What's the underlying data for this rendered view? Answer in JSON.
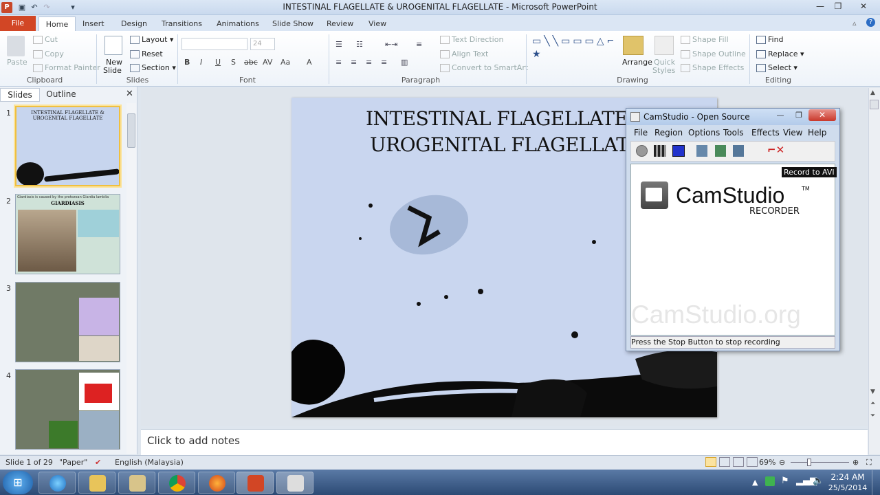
{
  "titlebar": {
    "title": "INTESTINAL FLAGELLATE & UROGENITAL FLAGELLATE - Microsoft PowerPoint",
    "app_icon": "P"
  },
  "ribbon_tabs": {
    "file": "File",
    "tabs": [
      "Home",
      "Insert",
      "Design",
      "Transitions",
      "Animations",
      "Slide Show",
      "Review",
      "View"
    ]
  },
  "clipboard": {
    "paste": "Paste",
    "cut": "Cut",
    "copy": "Copy",
    "format_painter": "Format Painter",
    "label": "Clipboard"
  },
  "slides_group": {
    "new_slide_1": "New",
    "new_slide_2": "Slide",
    "layout": "Layout",
    "reset": "Reset",
    "section": "Section",
    "label": "Slides"
  },
  "font_group": {
    "font_size": "24",
    "label": "Font"
  },
  "paragraph_group": {
    "text_direction": "Text Direction",
    "align_text": "Align Text",
    "convert_smartart": "Convert to SmartArt",
    "label": "Paragraph"
  },
  "drawing_group": {
    "arrange": "Arrange",
    "quick_styles_1": "Quick",
    "quick_styles_2": "Styles",
    "shape_fill": "Shape Fill",
    "shape_outline": "Shape Outline",
    "shape_effects": "Shape Effects",
    "label": "Drawing"
  },
  "editing_group": {
    "find": "Find",
    "replace": "Replace",
    "select": "Select",
    "label": "Editing"
  },
  "left_panel": {
    "tab_slides": "Slides",
    "tab_outline": "Outline",
    "thumbnails": [
      {
        "num": "1",
        "title1": "INTESTINAL FLAGELLATE &",
        "title2": "UROGENITAL FLAGELLATE"
      },
      {
        "num": "2",
        "caption": "Giardiasis is caused by the protozoan Giardia lamblia",
        "title": "GIARDIASIS"
      },
      {
        "num": "3"
      },
      {
        "num": "4"
      }
    ]
  },
  "slide": {
    "title_line1": "INTESTINAL FLAGELLATE &",
    "title_line2": "UROGENITAL FLAGELLATE"
  },
  "notes": {
    "placeholder": "Click to add notes"
  },
  "status": {
    "slide": "Slide 1 of 29",
    "theme": "\"Paper\"",
    "language": "English (Malaysia)",
    "zoom": "69%"
  },
  "camstudio": {
    "title": "CamStudio - Open Source",
    "menu": [
      "File",
      "Region",
      "Options",
      "Tools",
      "Effects",
      "View",
      "Help"
    ],
    "tooltip": "Record to AVI",
    "logo_main": "CamStudio",
    "logo_tm": "TM",
    "logo_sub": "RECORDER",
    "watermark": "CamStudio.org",
    "status": "Press the Stop Button to stop recording"
  },
  "taskbar": {
    "time": "2:24 AM",
    "date": "25/5/2014"
  },
  "colors": {
    "file_tab": "#d24625",
    "accent": "#2b579a"
  }
}
